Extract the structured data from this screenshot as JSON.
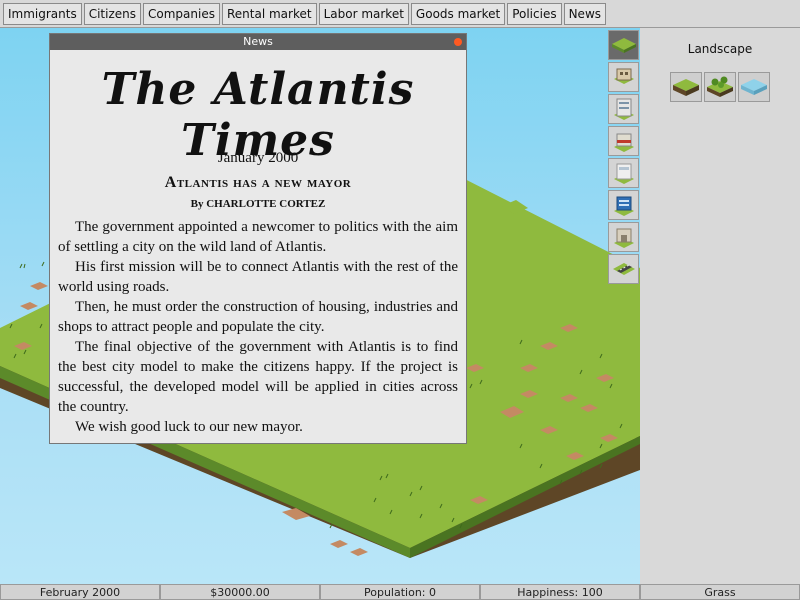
{
  "menu": {
    "items": [
      "Immigrants",
      "Citizens",
      "Companies",
      "Rental market",
      "Labor market",
      "Goods market",
      "Policies",
      "News"
    ]
  },
  "panel": {
    "title": "Landscape",
    "landscape_tools": [
      "grass-tile-icon",
      "trees-tile-icon",
      "water-tile-icon"
    ]
  },
  "tools": [
    "landscape-icon",
    "house-icon",
    "apartment-icon",
    "shop-icon",
    "office-icon",
    "factory-icon",
    "warehouse-icon",
    "road-icon"
  ],
  "news_window": {
    "title": "News",
    "masthead": "The Atlantis Times",
    "date": "January 2000",
    "headline": "Atlantis has a new mayor",
    "byline": "By CHARLOTTE CORTEZ",
    "paragraphs": [
      "The government appointed a newcomer to politics with the aim of settling a city on the wild land of Atlantis.",
      "His first mission will be to connect Atlantis with the rest of the world using roads.",
      "Then, he must order the construction of housing, industries and shops to attract people and populate the city.",
      "The final objective of the government with Atlantis is to find the best city model to make the citizens happy. If the project is successful, the developed model will be applied in cities across the country.",
      "We wish good luck to our new mayor."
    ]
  },
  "status": {
    "date": "February 2000",
    "money": "$30000.00",
    "population": "Population: 0",
    "happiness": "Happiness: 100",
    "terrain": "Grass"
  },
  "colors": {
    "sky": "#8fd6f3",
    "grass_top": "#8fba3e",
    "grass_side": "#5c8a2a",
    "soil": "#7a5a30",
    "dirt_patch": "#c48a63",
    "titlebar": "#5e5e5e",
    "close": "#ff5a22",
    "active_tool": "#6a6a6a"
  }
}
